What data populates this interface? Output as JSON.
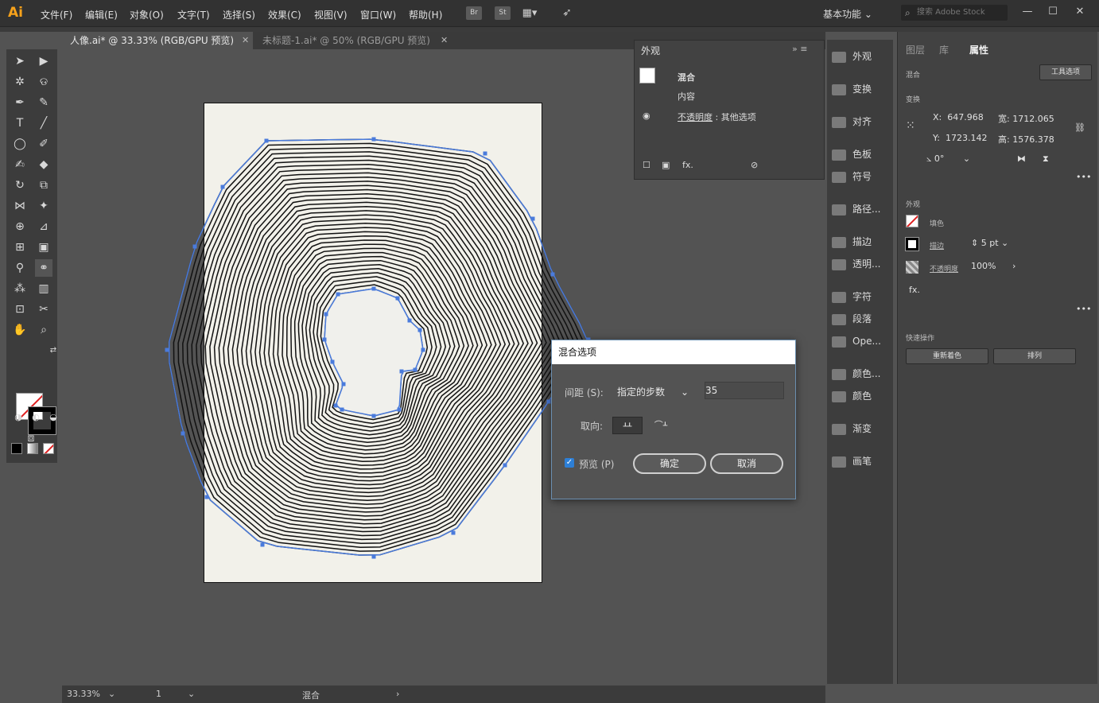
{
  "app": {
    "logo": "Ai"
  },
  "menu": [
    "文件(F)",
    "编辑(E)",
    "对象(O)",
    "文字(T)",
    "选择(S)",
    "效果(C)",
    "视图(V)",
    "窗口(W)",
    "帮助(H)"
  ],
  "menubar_icons": {
    "bridge": "Br",
    "stock": "St",
    "arrange_icon": "grid-icon",
    "gpu_icon": "rocket-icon"
  },
  "workspace": "基本功能",
  "search_placeholder": "搜索 Adobe Stock",
  "tabs": [
    {
      "label": "人像.ai* @ 33.33% (RGB/GPU 预览)",
      "close": "✕"
    },
    {
      "label": "未标题-1.ai* @ 50% (RGB/GPU 预览)",
      "close": "✕"
    }
  ],
  "appearance": {
    "title": "外观",
    "item_blend": "混合",
    "item_contents": "内容",
    "opacity_label": "不透明度",
    "opacity_value": "其他选项"
  },
  "dock": [
    {
      "label": "外观",
      "icon": "sun-icon"
    },
    {
      "label": "变换",
      "icon": "transform-icon"
    },
    {
      "label": "对齐",
      "icon": "align-icon"
    },
    {
      "label": "色板",
      "icon": "swatches-icon"
    },
    {
      "label": "符号",
      "icon": "club-icon"
    },
    {
      "label": "路径...",
      "icon": "pathfinder-icon"
    },
    {
      "label": "描边",
      "icon": "stroke-lines-icon"
    },
    {
      "label": "透明...",
      "icon": "transparency-icon"
    },
    {
      "label": "字符",
      "icon": "character-icon"
    },
    {
      "label": "段落",
      "icon": "paragraph-icon"
    },
    {
      "label": "Ope...",
      "icon": "opentype-icon"
    },
    {
      "label": "颜色...",
      "icon": "color-guide-icon"
    },
    {
      "label": "颜色",
      "icon": "color-palette-icon"
    },
    {
      "label": "渐变",
      "icon": "gradient-icon"
    },
    {
      "label": "画笔",
      "icon": "brush-icon"
    }
  ],
  "properties": {
    "tabs": [
      "图层",
      "库",
      "属性"
    ],
    "section_blend": "混合",
    "tool_options": "工具选项",
    "section_transform": "变换",
    "x_label": "X:",
    "x_value": "647.968",
    "y_label": "Y:",
    "y_value": "1723.142",
    "w_label": "宽:",
    "w_value": "1712.065",
    "h_label": "高:",
    "h_value": "1576.378",
    "angle_value": "0°",
    "section_appearance": "外观",
    "fill_label": "填色",
    "stroke_label": "描边",
    "stroke_value": "5 pt",
    "opacity_label": "不透明度",
    "opacity_value": "100%",
    "fx": "fx.",
    "section_quick": "快速操作",
    "btn_recolor": "重新着色",
    "btn_arrange": "排列"
  },
  "dialog": {
    "title": "混合选项",
    "spacing_label": "间距 (S):",
    "spacing_value": "指定的步数",
    "steps_value": "35",
    "orient_label": "取向:",
    "preview_label": "预览 (P)",
    "ok_label": "确定",
    "cancel_label": "取消"
  },
  "status": {
    "zoom": "33.33%",
    "artboard": "1",
    "tool": "混合"
  },
  "colors": {
    "accent": "#f7a21b",
    "selection": "#4a7bdc",
    "none_slash": "#e02020"
  }
}
